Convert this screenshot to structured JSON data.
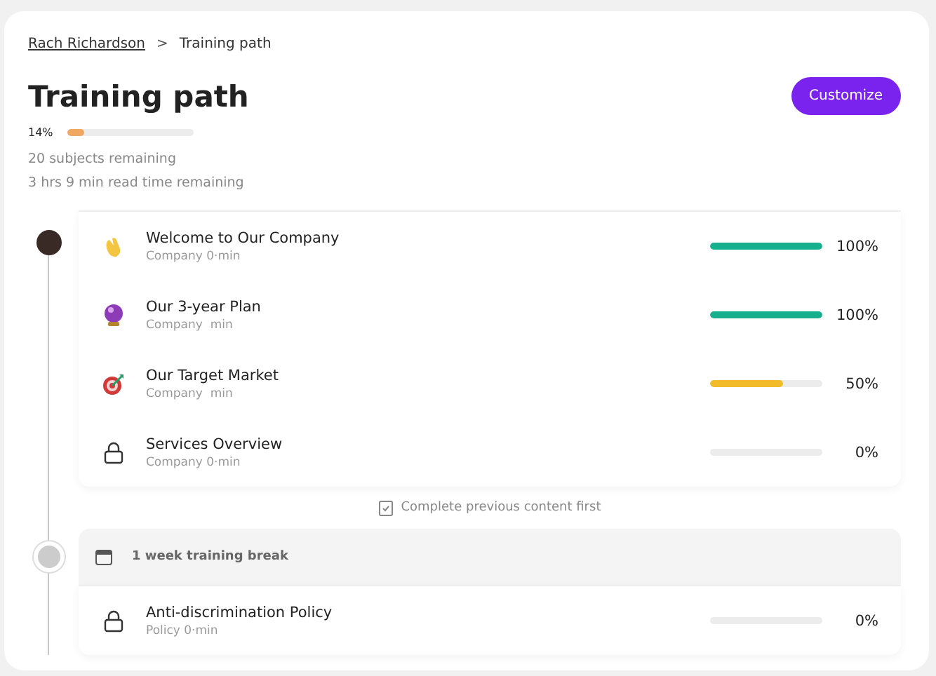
{
  "breadcrumb": {
    "parent": "Rach Richardson",
    "separator": ">",
    "current": "Training path"
  },
  "title": "Training path",
  "customize_button": "Customize",
  "overall_progress": {
    "label": "14%",
    "level": 0.14
  },
  "stats": [
    "20 subjects remaining",
    "3 hrs 9 min read time remaining"
  ],
  "sections": [
    {
      "kind": "avatar",
      "items": [
        {
          "kind": "wave",
          "title": "Welcome to Our Company",
          "subtitle": "Company 0·min",
          "level": 1,
          "color": "#17b08f",
          "reading": "100%"
        },
        {
          "kind": "crystal-ball",
          "title": "Our 3-year Plan",
          "subtitle": "Company  min",
          "level": 1,
          "color": "#17b08f",
          "reading": "100%"
        },
        {
          "kind": "target",
          "title": "Our Target Market",
          "subtitle": "Company  min",
          "level": 0.65,
          "color": "#f2bb2a",
          "reading": "50%"
        },
        {
          "kind": "lock",
          "title": "Services Overview",
          "subtitle": "Company 0·min",
          "reading": "0%"
        }
      ],
      "note": "Complete previous content first"
    },
    {
      "kind": "dot",
      "break": "1 week training break",
      "items": [
        {
          "kind": "lock",
          "title": "Anti-discrimination Policy",
          "subtitle": "Policy 0·min",
          "reading": "0%"
        }
      ]
    }
  ]
}
